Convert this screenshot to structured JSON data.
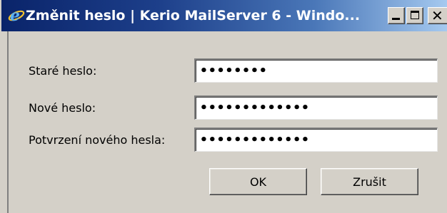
{
  "window": {
    "title": "Změnit heslo | Kerio MailServer 6 - Windo...",
    "close_glyph": "✕"
  },
  "form": {
    "fields": [
      {
        "label": "Staré heslo:",
        "value": "••••••••"
      },
      {
        "label": "Nové heslo:",
        "value": "•••••••••••••"
      },
      {
        "label": "Potvrzení nového hesla:",
        "value": "•••••••••••••"
      }
    ]
  },
  "buttons": {
    "ok": "OK",
    "cancel": "Zrušit"
  }
}
